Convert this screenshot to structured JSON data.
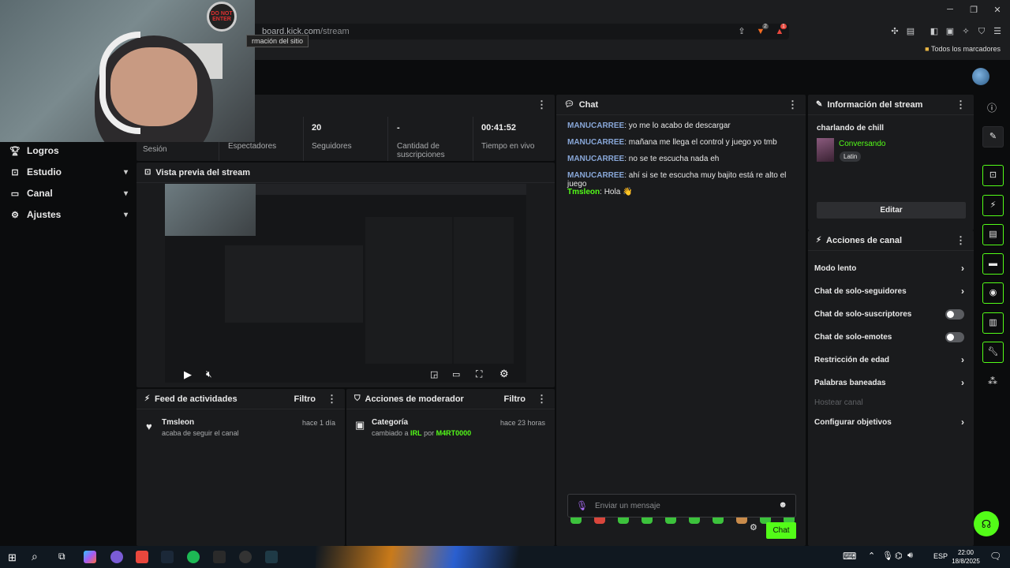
{
  "browser": {
    "url_domain": "board.kick.com",
    "url_path": "/stream",
    "tooltip": "rmación del sitio",
    "bookmarks_label": "Todos los marcadores",
    "brave_badge": "2",
    "alert_badge": "1"
  },
  "webcam": {
    "poster_text_1": "DO NOT",
    "poster_text_2": "ENTER"
  },
  "sidebar": {
    "items": [
      {
        "label": "Logros",
        "icon": "trophy-icon"
      },
      {
        "label": "Estudio",
        "icon": "studio-icon"
      },
      {
        "label": "Canal",
        "icon": "channel-icon"
      },
      {
        "label": "Ajustes",
        "icon": "gear-icon"
      }
    ]
  },
  "stats": {
    "session_label": "Sesión",
    "viewers_label": "Espectadores",
    "followers_value": "20",
    "followers_label": "Seguidores",
    "subs_value": "-",
    "subs_label": "Cantidad de suscripciones",
    "live_value": "00:41:52",
    "live_label": "Tiempo en vivo"
  },
  "preview": {
    "title": "Vista previa del stream"
  },
  "chat": {
    "title": "Chat",
    "messages": [
      {
        "user": "MANUCARREE",
        "text": "yo me lo acabo de descargar"
      },
      {
        "user": "MANUCARREE",
        "text": "mañana me llega el control y juego yo tmb"
      },
      {
        "user": "MANUCARREE",
        "text": "no se te escucha nada eh"
      },
      {
        "user": "MANUCARREE",
        "text": "ahí si se te escucha muy bajito está re alto el juego"
      },
      {
        "user": "Tmsleon",
        "text": "Hola 👋"
      }
    ],
    "input_placeholder": "Enviar un mensaje",
    "send_label": "Chat"
  },
  "stream_info": {
    "title": "Información del stream",
    "stream_title": "charlando de chill",
    "category": "Conversando",
    "tag": "Latin",
    "edit_label": "Editar"
  },
  "channel_actions": {
    "title": "Acciones de canal",
    "items": [
      {
        "label": "Modo lento",
        "control": "chevron"
      },
      {
        "label": "Chat de solo-seguidores",
        "control": "chevron"
      },
      {
        "label": "Chat de solo-suscriptores",
        "control": "toggle"
      },
      {
        "label": "Chat de solo-emotes",
        "control": "toggle"
      },
      {
        "label": "Restricción de edad",
        "control": "chevron"
      },
      {
        "label": "Palabras baneadas",
        "control": "chevron"
      },
      {
        "label": "Hostear canal",
        "control": "disabled"
      },
      {
        "label": "Configurar objetivos",
        "control": "chevron"
      }
    ]
  },
  "activity_feed": {
    "title": "Feed de actividades",
    "filter_label": "Filtro",
    "user": "Tmsleon",
    "action": "acaba de seguir el canal",
    "time": "hace 1 día"
  },
  "mod_actions": {
    "title": "Acciones de moderador",
    "filter_label": "Filtro",
    "entry_title": "Categoría",
    "entry_prefix": "cambiado a",
    "entry_value": "IRL",
    "entry_by": "por",
    "entry_user": "M4RT0000",
    "time": "hace 23 horas"
  },
  "taskbar": {
    "lang": "ESP",
    "time": "22:00",
    "date": "18/8/2025"
  },
  "colors": {
    "accent": "#53fc18",
    "user_blue": "#88a7d8"
  }
}
